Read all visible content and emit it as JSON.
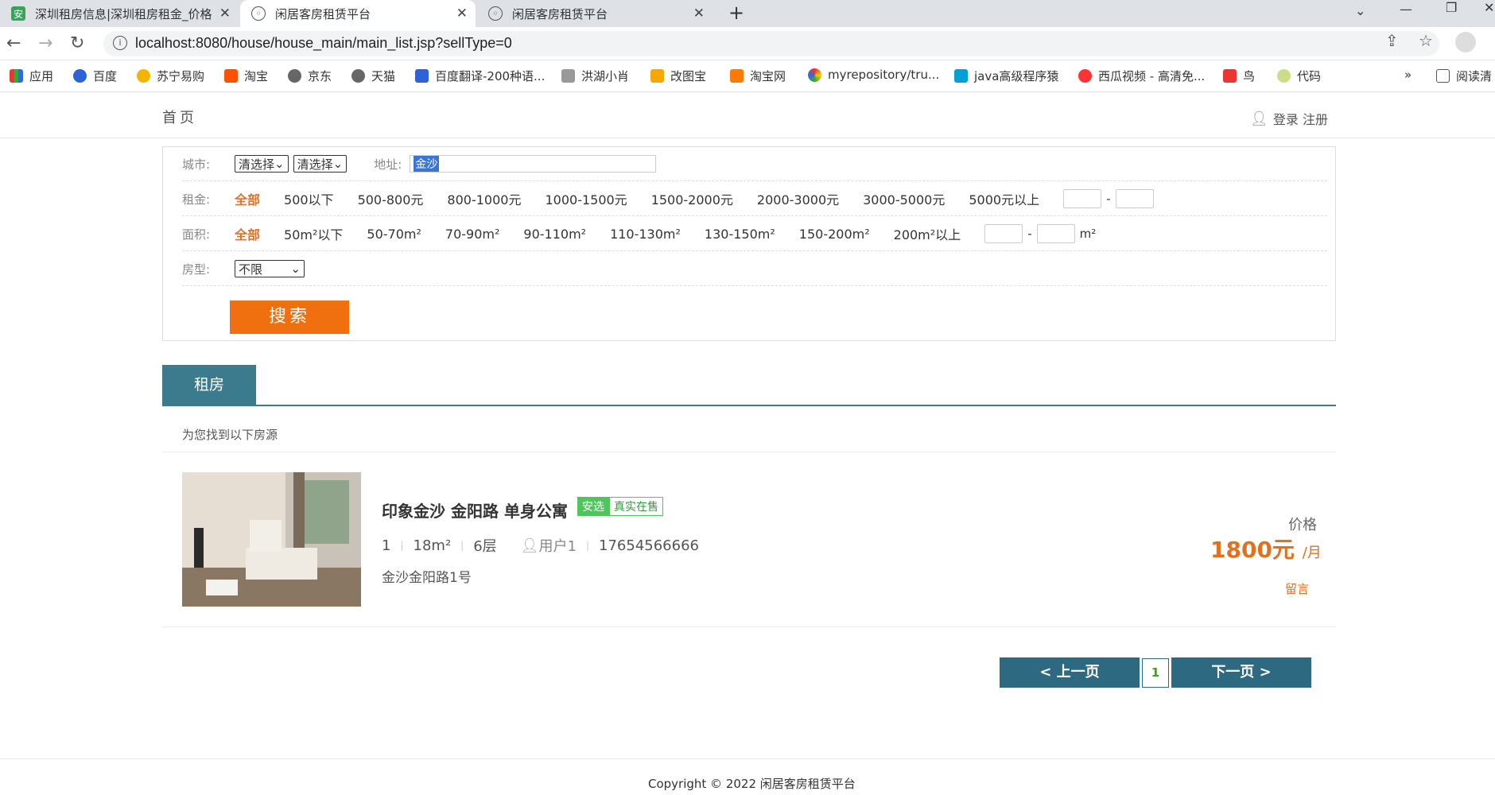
{
  "browser": {
    "tabs": [
      {
        "title": "深圳租房信息|深圳租房租金_价格",
        "icon": "site-favicon"
      },
      {
        "title": "闲居客房租赁平台",
        "icon": "globe-icon"
      },
      {
        "title": "闲居客房租赁平台",
        "icon": "globe-icon"
      }
    ],
    "url": "localhost:8080/house/house_main/main_list.jsp?sellType=0",
    "bookmarks": [
      "应用",
      "百度",
      "苏宁易购",
      "淘宝",
      "京东",
      "天猫",
      "百度翻译-200种语...",
      "洪湖小肖",
      "改图宝",
      "淘宝网",
      "myrepository/tru...",
      "java高级程序猿",
      "西瓜视频 - 高清免...",
      "鸟",
      "代码"
    ],
    "bookmarks_more": "»",
    "reading_list": "阅读清"
  },
  "header": {
    "home": "首页",
    "login": "登录 注册"
  },
  "filter": {
    "city_label": "城市:",
    "city_select1": "清选择",
    "city_select2": "清选择",
    "address_label": "地址:",
    "address_value": "金沙",
    "rent_label": "租金:",
    "rent_options": [
      "全部",
      "500以下",
      "500-800元",
      "800-1000元",
      "1000-1500元",
      "1500-2000元",
      "2000-3000元",
      "3000-5000元",
      "5000元以上"
    ],
    "area_label": "面积:",
    "area_options": [
      "全部",
      "50m²以下",
      "50-70m²",
      "70-90m²",
      "90-110m²",
      "110-130m²",
      "130-150m²",
      "150-200m²",
      "200m²以上"
    ],
    "area_unit": "m²",
    "range_dash": "-",
    "type_label": "房型:",
    "type_value": "不限",
    "search_button": "搜索"
  },
  "results": {
    "tab_label": "租房",
    "found_text": "为您找到以下房源",
    "listing": {
      "title": "印象金沙 金阳路 单身公寓",
      "badge1": "安选",
      "badge2": "真实在售",
      "rooms": "1",
      "area": "18m²",
      "floor": "6层",
      "user": "用户1",
      "phone": "17654566666",
      "address": "金沙金阳路1号",
      "price_label": "价格",
      "price": "1800元",
      "price_unit": "/月",
      "message": "留言"
    }
  },
  "pagination": {
    "prev": "< 上一页",
    "current": "1",
    "next": "下一页 >"
  },
  "footer": {
    "copyright": "Copyright © 2022 闲居客房租赁平台"
  }
}
